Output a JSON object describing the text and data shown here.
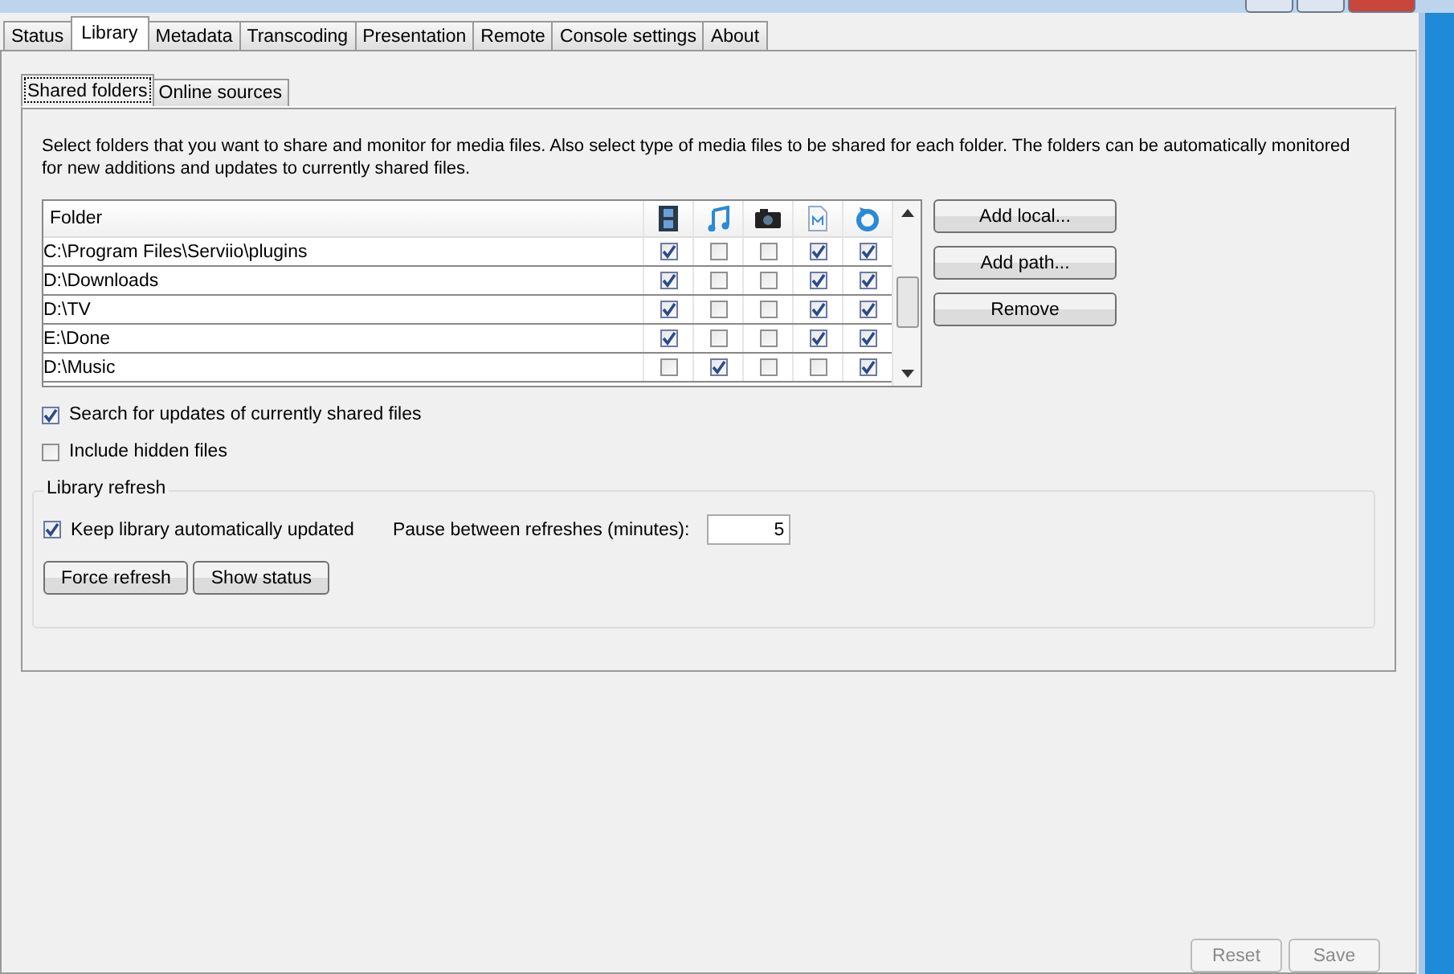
{
  "tabs": [
    {
      "label": "Status",
      "selected": false
    },
    {
      "label": "Library",
      "selected": true
    },
    {
      "label": "Metadata",
      "selected": false
    },
    {
      "label": "Transcoding",
      "selected": false
    },
    {
      "label": "Presentation",
      "selected": false
    },
    {
      "label": "Remote",
      "selected": false
    },
    {
      "label": "Console settings",
      "selected": false
    },
    {
      "label": "About",
      "selected": false
    }
  ],
  "subtabs": [
    {
      "label": "Shared folders",
      "selected": true
    },
    {
      "label": "Online sources",
      "selected": false
    }
  ],
  "description": "Select folders that you want to share and monitor for media files. Also select type of media files to be shared for each folder. The folders can be automatically monitored for new additions and updates to currently shared files.",
  "table": {
    "columns": [
      "Folder"
    ],
    "rows": [
      {
        "folder": "C:\\Program Files\\Serviio\\plugins",
        "checks": [
          true,
          false,
          false,
          true,
          true
        ]
      },
      {
        "folder": "D:\\Downloads",
        "checks": [
          true,
          false,
          false,
          true,
          true
        ]
      },
      {
        "folder": "D:\\TV",
        "checks": [
          true,
          false,
          false,
          true,
          true
        ]
      },
      {
        "folder": "E:\\Done",
        "checks": [
          true,
          false,
          false,
          true,
          true
        ]
      },
      {
        "folder": "D:\\Music",
        "checks": [
          false,
          true,
          false,
          false,
          true
        ]
      }
    ]
  },
  "side_buttons": [
    "Add local...",
    "Add path...",
    "Remove"
  ],
  "options": [
    {
      "label": "Search for updates of currently shared files",
      "checked": true
    },
    {
      "label": "Include hidden files",
      "checked": false
    }
  ],
  "refresh": {
    "title": "Library refresh",
    "auto": {
      "label": "Keep library automatically updated",
      "checked": true
    },
    "pause_label": "Pause between refreshes (minutes):",
    "pause_value": "5",
    "buttons": [
      "Force refresh",
      "Show status"
    ]
  },
  "footer_buttons": [
    {
      "label": "Reset",
      "disabled": true
    },
    {
      "label": "Save",
      "disabled": true
    }
  ]
}
